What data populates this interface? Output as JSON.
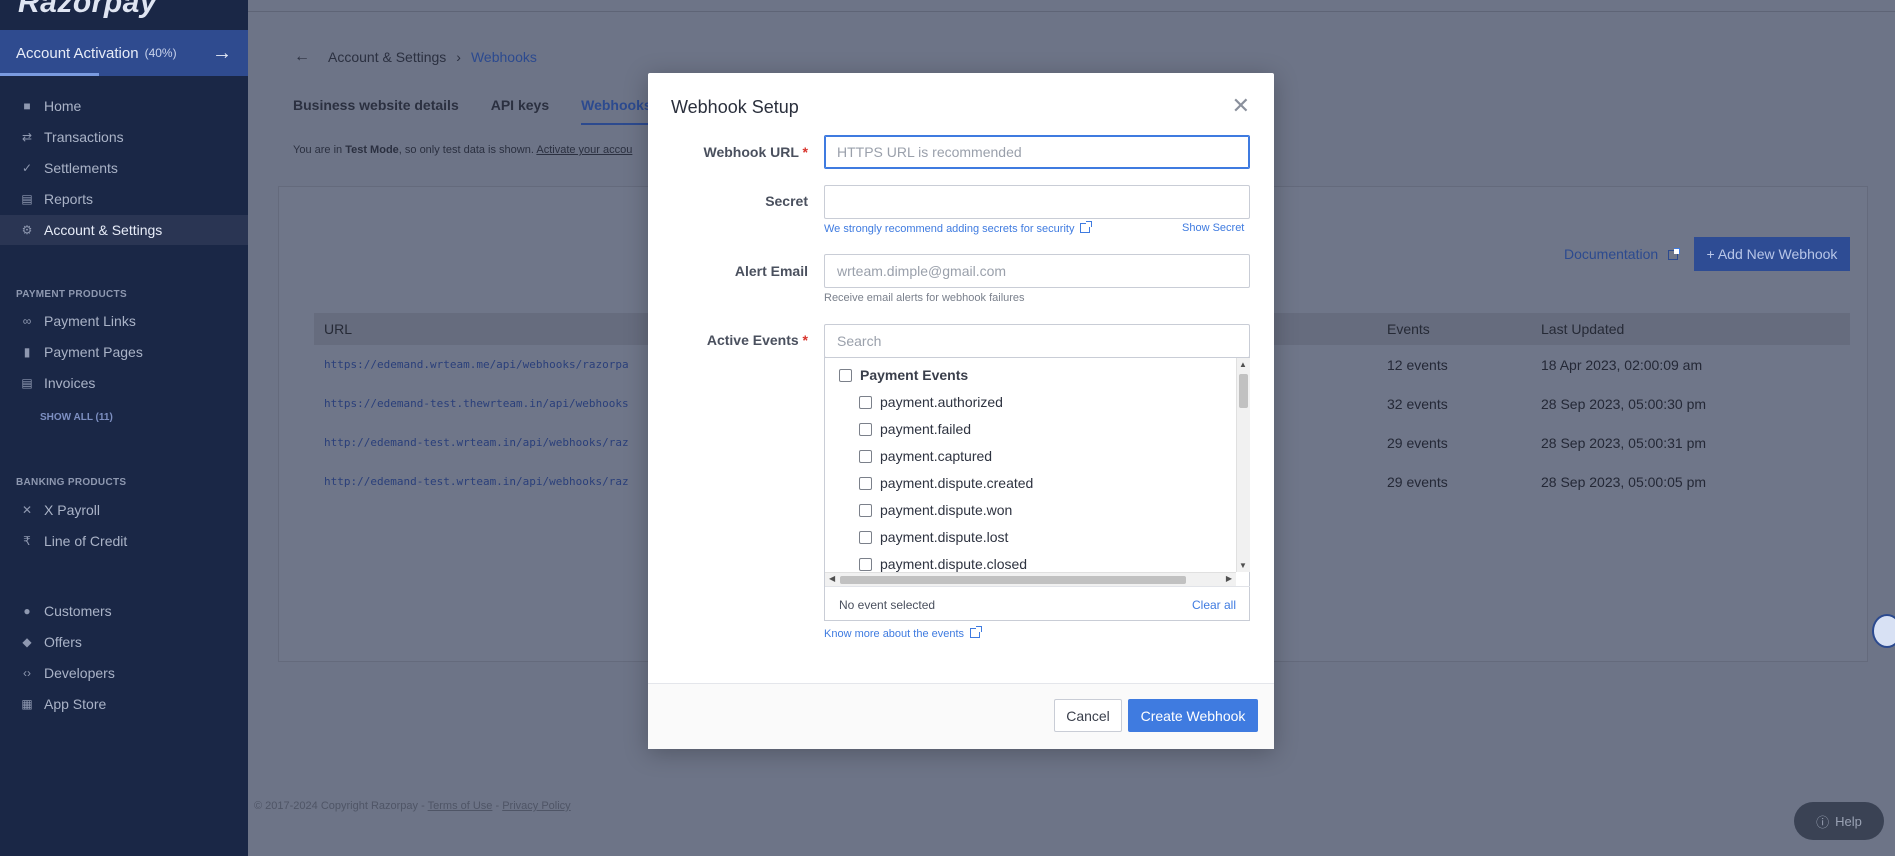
{
  "sidebar": {
    "logo": "Razorpay",
    "activation": {
      "label": "Account Activation",
      "percent": "(40%)",
      "progress": 0.4
    },
    "items": [
      {
        "label": "Home",
        "icon": "home-icon"
      },
      {
        "label": "Transactions",
        "icon": "transactions-icon"
      },
      {
        "label": "Settlements",
        "icon": "settlements-icon"
      },
      {
        "label": "Reports",
        "icon": "reports-icon"
      },
      {
        "label": "Account & Settings",
        "icon": "gear-icon"
      }
    ],
    "payment_products": {
      "heading": "PAYMENT PRODUCTS",
      "items": [
        {
          "label": "Payment Links",
          "icon": "link-icon"
        },
        {
          "label": "Payment Pages",
          "icon": "page-icon"
        },
        {
          "label": "Invoices",
          "icon": "invoice-icon"
        }
      ],
      "show_all": "SHOW ALL (11)"
    },
    "banking_products": {
      "heading": "BANKING PRODUCTS",
      "items": [
        {
          "label": "X Payroll",
          "icon": "payroll-icon"
        },
        {
          "label": "Line of Credit",
          "icon": "rupee-icon"
        }
      ]
    },
    "bottom_items": [
      {
        "label": "Customers",
        "icon": "customers-icon"
      },
      {
        "label": "Offers",
        "icon": "tag-icon"
      },
      {
        "label": "Developers",
        "icon": "code-icon"
      },
      {
        "label": "App Store",
        "icon": "grid-icon"
      }
    ]
  },
  "main": {
    "breadcrumb": {
      "parent": "Account & Settings",
      "current": "Webhooks"
    },
    "tabs": [
      "Business website details",
      "API keys",
      "Webhooks"
    ],
    "test_mode": {
      "prefix": "You are in",
      "mode": "Test Mode",
      "middle": ", so only test data is shown.",
      "link": "Activate your accou"
    },
    "documentation": "Documentation",
    "add_button": "+ Add New Webhook",
    "table": {
      "headers": {
        "url": "URL",
        "events": "Events",
        "updated": "Last Updated"
      },
      "rows": [
        {
          "url": "https://edemand.wrteam.me/api/webhooks/razorpa",
          "events": "12 events",
          "updated": "18 Apr 2023, 02:00:09 am"
        },
        {
          "url": "https://edemand-test.thewrteam.in/api/webhooks",
          "events": "32 events",
          "updated": "28 Sep 2023, 05:00:30 pm"
        },
        {
          "url": "http://edemand-test.wrteam.in/api/webhooks/raz",
          "events": "29 events",
          "updated": "28 Sep 2023, 05:00:31 pm"
        },
        {
          "url": "http://edemand-test.wrteam.in/api/webhooks/raz",
          "events": "29 events",
          "updated": "28 Sep 2023, 05:00:05 pm"
        }
      ]
    },
    "footer": {
      "copyright": "© 2017-2024 Copyright Razorpay -",
      "terms": "Terms of Use",
      "sep": "-",
      "privacy": "Privacy Policy"
    },
    "help": "Help"
  },
  "modal": {
    "title": "Webhook Setup",
    "url_label": "Webhook URL",
    "url_placeholder": "HTTPS URL is recommended",
    "secret_label": "Secret",
    "secret_hint": "We strongly recommend adding secrets for security",
    "show_secret": "Show Secret",
    "email_label": "Alert Email",
    "email_placeholder": "wrteam.dimple@gmail.com",
    "email_hint": "Receive email alerts for webhook failures",
    "events_label": "Active Events",
    "search_placeholder": "Search",
    "event_group": "Payment Events",
    "events": [
      "payment.authorized",
      "payment.failed",
      "payment.captured",
      "payment.dispute.created",
      "payment.dispute.won",
      "payment.dispute.lost",
      "payment.dispute.closed"
    ],
    "no_event": "No event selected",
    "clear_all": "Clear all",
    "know_more": "Know more about the events",
    "cancel": "Cancel",
    "create": "Create Webhook"
  }
}
